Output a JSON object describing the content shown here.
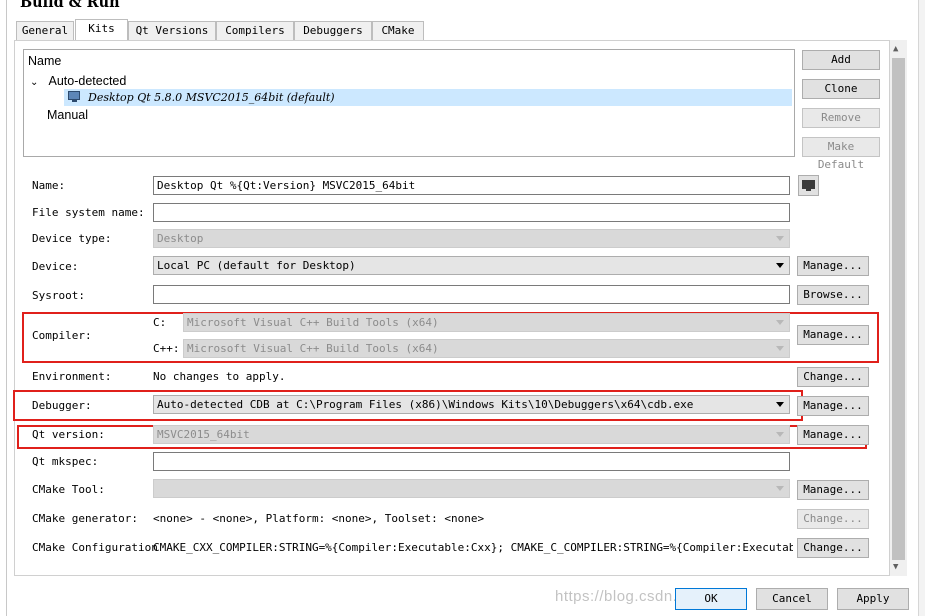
{
  "page_title": "Build & Run",
  "tabs": [
    "General",
    "Kits",
    "Qt Versions",
    "Compilers",
    "Debuggers",
    "CMake"
  ],
  "active_tab": "Kits",
  "tree": {
    "header": "Name",
    "auto_detected": "Auto-detected",
    "selected_kit": "Desktop Qt 5.8.0 MSVC2015_64bit (default)",
    "manual": "Manual"
  },
  "side_buttons": {
    "add": "Add",
    "clone": "Clone",
    "remove": "Remove",
    "make_default": "Make Default"
  },
  "form": {
    "name_label": "Name:",
    "name_value": "Desktop Qt %{Qt:Version} MSVC2015_64bit",
    "filesystem_label": "File system name:",
    "filesystem_value": "",
    "device_type_label": "Device type:",
    "device_type_value": "Desktop",
    "device_label": "Device:",
    "device_value": "Local PC (default for Desktop)",
    "sysroot_label": "Sysroot:",
    "sysroot_value": "",
    "compiler_label": "Compiler:",
    "compiler_c_label": "C:",
    "compiler_c_value": "Microsoft Visual C++ Build Tools (x64)",
    "compiler_cpp_label": "C++:",
    "compiler_cpp_value": "Microsoft Visual C++ Build Tools (x64)",
    "environment_label": "Environment:",
    "environment_value": "No changes to apply.",
    "debugger_label": "Debugger:",
    "debugger_value": "Auto-detected CDB at C:\\Program Files (x86)\\Windows Kits\\10\\Debuggers\\x64\\cdb.exe",
    "qt_version_label": "Qt version:",
    "qt_version_value": "MSVC2015_64bit",
    "qt_mkspec_label": "Qt mkspec:",
    "qt_mkspec_value": "",
    "cmake_tool_label": "CMake Tool:",
    "cmake_tool_value": "",
    "cmake_generator_label": "CMake generator:",
    "cmake_generator_value": "<none> - <none>, Platform: <none>, Toolset: <none>",
    "cmake_config_label": "CMake Configuration",
    "cmake_config_value": "CMAKE_CXX_COMPILER:STRING=%{Compiler:Executable:Cxx}; CMAKE_C_COMPILER:STRING=%{Compiler:Executable:C}; …"
  },
  "row_buttons": {
    "manage": "Manage...",
    "browse": "Browse...",
    "change": "Change..."
  },
  "bottom_buttons": {
    "ok": "OK",
    "cancel": "Cancel",
    "apply": "Apply"
  },
  "watermark": "https://blog.csdn.net/...",
  "highlight_color": "#e0201b",
  "selection_color": "#cce8ff"
}
